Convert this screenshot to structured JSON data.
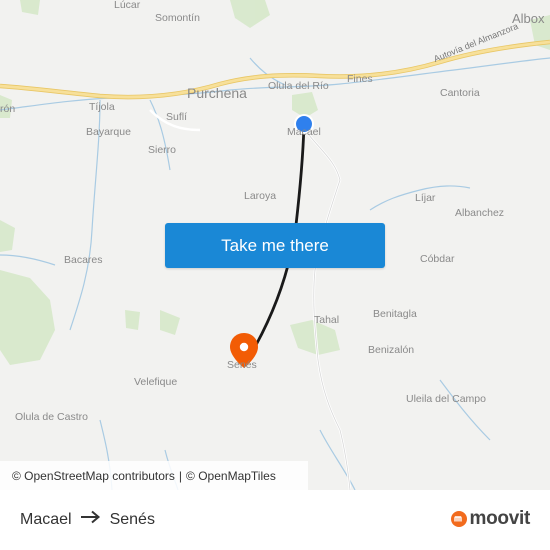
{
  "map": {
    "places": [
      {
        "id": "lucar",
        "name": "Lúcar"
      },
      {
        "id": "somontin",
        "name": "Somontín"
      },
      {
        "id": "albox",
        "name": "Albox"
      },
      {
        "id": "purchena",
        "name": "Purchena"
      },
      {
        "id": "olula-del-rio",
        "name": "Olula del Río"
      },
      {
        "id": "fines",
        "name": "Fines"
      },
      {
        "id": "cantoria",
        "name": "Cantoria"
      },
      {
        "id": "tijola",
        "name": "Tíjola"
      },
      {
        "id": "armuna",
        "name": "rón"
      },
      {
        "id": "bayarque",
        "name": "Bayarque"
      },
      {
        "id": "sufli",
        "name": "Suflí"
      },
      {
        "id": "macael",
        "name": "Macael"
      },
      {
        "id": "sierro",
        "name": "Sierro"
      },
      {
        "id": "laroya",
        "name": "Laroya"
      },
      {
        "id": "lijar",
        "name": "Líjar"
      },
      {
        "id": "albanchez",
        "name": "Albanchez"
      },
      {
        "id": "bacares",
        "name": "Bacares"
      },
      {
        "id": "cobdar",
        "name": "Cóbdar"
      },
      {
        "id": "tahal",
        "name": "Tahal"
      },
      {
        "id": "benitagla",
        "name": "Benitagla"
      },
      {
        "id": "benizalon",
        "name": "Benizalón"
      },
      {
        "id": "senes",
        "name": "Senés"
      },
      {
        "id": "velefique",
        "name": "Velefique"
      },
      {
        "id": "uleila-del-campo",
        "name": "Uleila del Campo"
      },
      {
        "id": "olula-de-castro",
        "name": "Olula de Castro"
      }
    ],
    "road_label": "Autovía del Almanzora",
    "origin_marker_color": "#2f80ed",
    "destination_marker_color": "#f25c05",
    "route_color": "#1a1a1a",
    "highway_color": "#f5d77a"
  },
  "cta": {
    "label": "Take me there",
    "color": "#1a88d6"
  },
  "attribution": {
    "osm": "© OpenStreetMap contributors",
    "separator": "|",
    "tiles": "© OpenMapTiles"
  },
  "footer": {
    "origin": "Macael",
    "destination": "Senés",
    "arrow_icon": "arrow-right-icon",
    "brand": "moovit",
    "brand_color": "#f26b1d"
  }
}
